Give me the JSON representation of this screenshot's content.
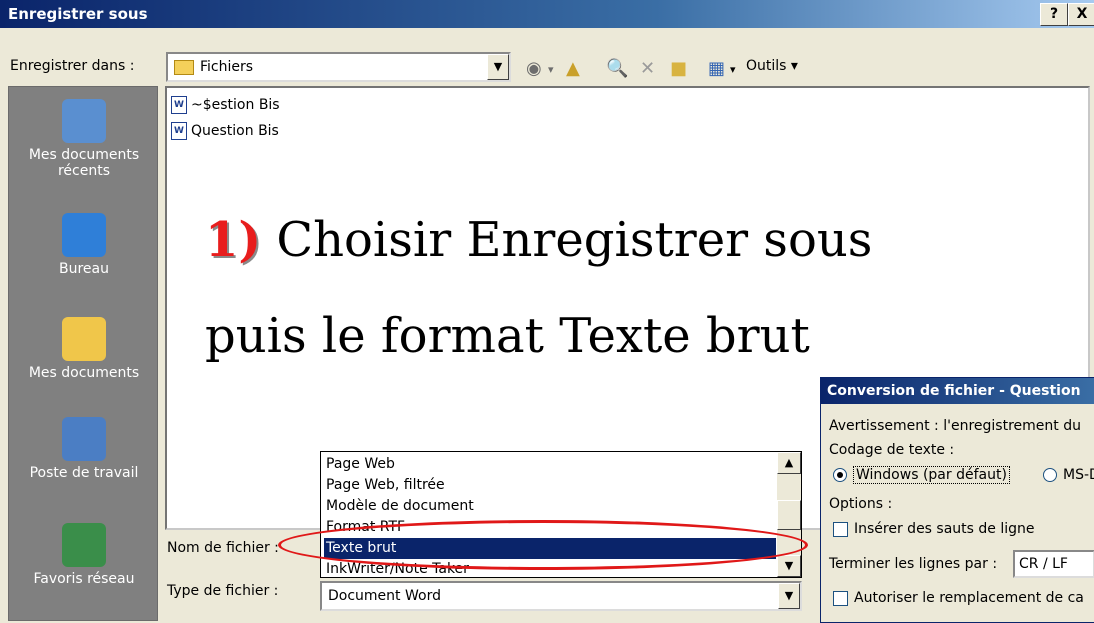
{
  "window": {
    "title": "Enregistrer sous",
    "help_btn": "?",
    "close_btn": "X"
  },
  "toolbar": {
    "save_in_label": "Enregistrer dans :",
    "current_folder": "Fichiers",
    "tools_label": "Outils"
  },
  "places": [
    {
      "label": "Mes documents récents",
      "icon": "recent-documents-icon"
    },
    {
      "label": "Bureau",
      "icon": "desktop-icon"
    },
    {
      "label": "Mes documents",
      "icon": "my-documents-icon"
    },
    {
      "label": "Poste de travail",
      "icon": "my-computer-icon"
    },
    {
      "label": "Favoris réseau",
      "icon": "network-places-icon"
    }
  ],
  "files": [
    {
      "name": "~$estion Bis"
    },
    {
      "name": "Question Bis"
    }
  ],
  "annotation": {
    "number": "1)",
    "line1": " Choisir Enregistrer sous",
    "line2": "puis le format Texte brut"
  },
  "form": {
    "filename_label": "Nom de fichier :",
    "filetype_label": "Type de fichier :",
    "filetype_value": "Document Word"
  },
  "dropdown": {
    "items": [
      "Page Web",
      "Page Web, filtrée",
      "Modèle de document",
      "Format RTF",
      "Texte brut",
      "InkWriter/Note Taker"
    ],
    "selected": "Texte brut"
  },
  "conversion_dialog": {
    "title": "Conversion de fichier - Question",
    "warning": "Avertissement : l'enregistrement du",
    "encoding_label": "Codage de texte :",
    "radio_windows": "Windows (par défaut)",
    "radio_msdos": "MS-D",
    "options_label": "Options :",
    "insert_breaks": "Insérer des sauts de ligne",
    "end_lines_label": "Terminer les lignes par :",
    "end_lines_value": "CR / LF",
    "allow_replace": "Autoriser le remplacement de ca"
  },
  "colors": {
    "title_blue": "#0a246a",
    "highlight": "#0a246a",
    "annotation_red": "#e81d1d",
    "oval_red": "#e01818"
  }
}
